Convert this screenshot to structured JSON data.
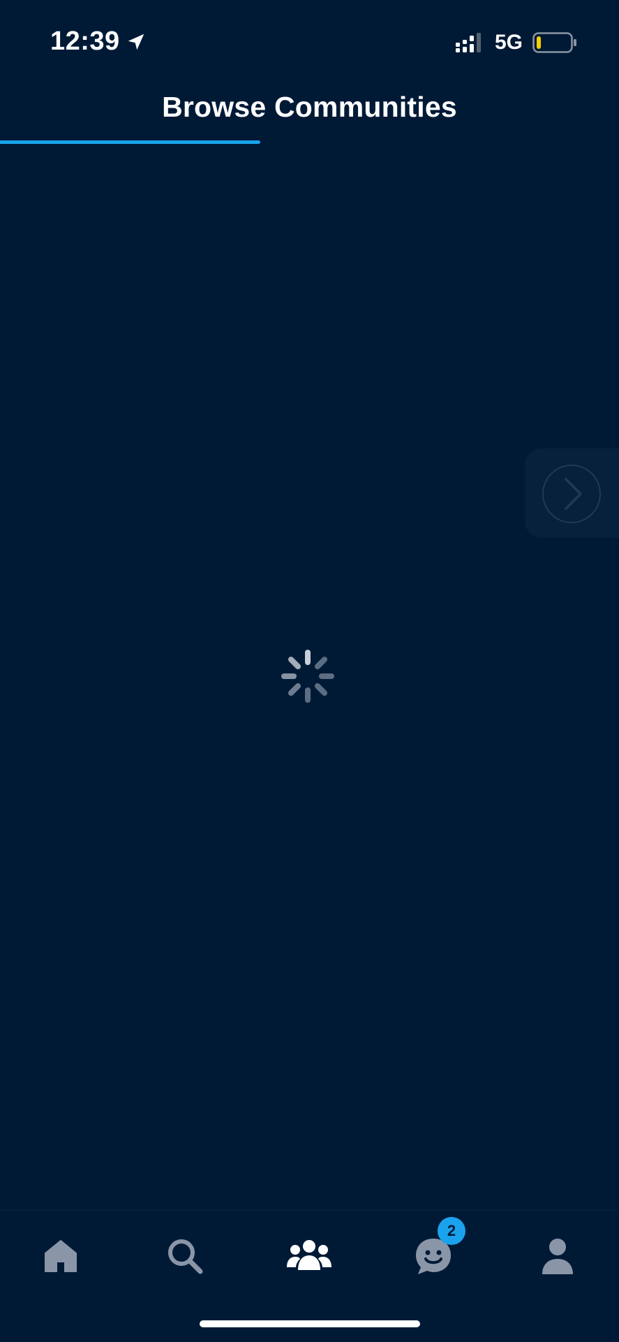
{
  "status_bar": {
    "time": "12:39",
    "network": "5G",
    "battery_level": 0.1,
    "battery_color": "#f5d000",
    "signal_bars": 3
  },
  "header": {
    "title": "Browse Communities",
    "progress": 0.42,
    "accent_color": "#1aa3ec"
  },
  "content": {
    "loading": true
  },
  "tab_bar": {
    "items": [
      {
        "name": "home",
        "icon": "home-icon",
        "active": false
      },
      {
        "name": "search",
        "icon": "search-icon",
        "active": false
      },
      {
        "name": "communities",
        "icon": "people-group-icon",
        "active": true
      },
      {
        "name": "chat",
        "icon": "chat-smile-icon",
        "active": false,
        "badge": "2"
      },
      {
        "name": "profile",
        "icon": "user-icon",
        "active": false
      }
    ]
  },
  "colors": {
    "background": "#001a36",
    "inactive_icon": "#8a96a8",
    "active_icon": "#ffffff"
  }
}
